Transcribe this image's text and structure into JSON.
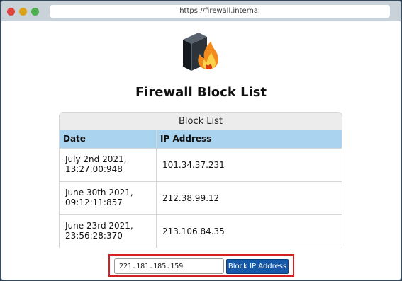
{
  "browser": {
    "url": "https://firewall.internal"
  },
  "logo": {
    "icon": "firewall-flame-icon"
  },
  "page": {
    "title": "Firewall Block List"
  },
  "block_list": {
    "caption": "Block List",
    "columns": [
      "Date",
      "IP Address"
    ],
    "rows": [
      {
        "date_line1": "July 2nd 2021,",
        "date_line2": "13:27:00:948",
        "ip": "101.34.37.231"
      },
      {
        "date_line1": "June 30th 2021,",
        "date_line2": "09:12:11:857",
        "ip": "212.38.99.12"
      },
      {
        "date_line1": "June 23rd 2021,",
        "date_line2": "23:56:28:370",
        "ip": "213.106.84.35"
      }
    ]
  },
  "form": {
    "ip_value": "221.181.185.159",
    "button_label": "Block IP Address"
  },
  "colors": {
    "header_row": "#a9d3ef",
    "button": "#1658a8",
    "highlight_border": "#d42020"
  }
}
